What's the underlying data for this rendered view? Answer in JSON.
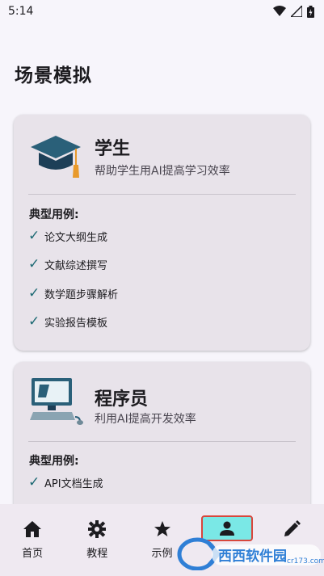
{
  "status_bar": {
    "time": "5:14"
  },
  "page": {
    "title": "场景模拟"
  },
  "cards": [
    {
      "title": "学生",
      "subtitle": "帮助学生用AI提高学习效率",
      "icon": "graduation-cap-icon",
      "examples_label": "典型用例:",
      "examples": [
        "论文大纲生成",
        "文献综述撰写",
        "数学题步骤解析",
        "实验报告模板"
      ]
    },
    {
      "title": "程序员",
      "subtitle": "利用AI提高开发效率",
      "icon": "computer-icon",
      "examples_label": "典型用例:",
      "examples": [
        "API文档生成"
      ]
    }
  ],
  "bottom_nav": {
    "items": [
      {
        "label": "首页",
        "icon": "home-icon"
      },
      {
        "label": "教程",
        "icon": "gear-icon"
      },
      {
        "label": "示例",
        "icon": "star-icon"
      },
      {
        "label": "",
        "icon": "person-icon",
        "active": true
      },
      {
        "label": "",
        "icon": "pencil-icon"
      }
    ]
  },
  "watermark": {
    "text": "西西软件园",
    "url_text": "cr173.com"
  },
  "colors": {
    "accent": "#7ae8e6",
    "check": "#1e6a74",
    "card_bg": "#e8e3ea"
  }
}
